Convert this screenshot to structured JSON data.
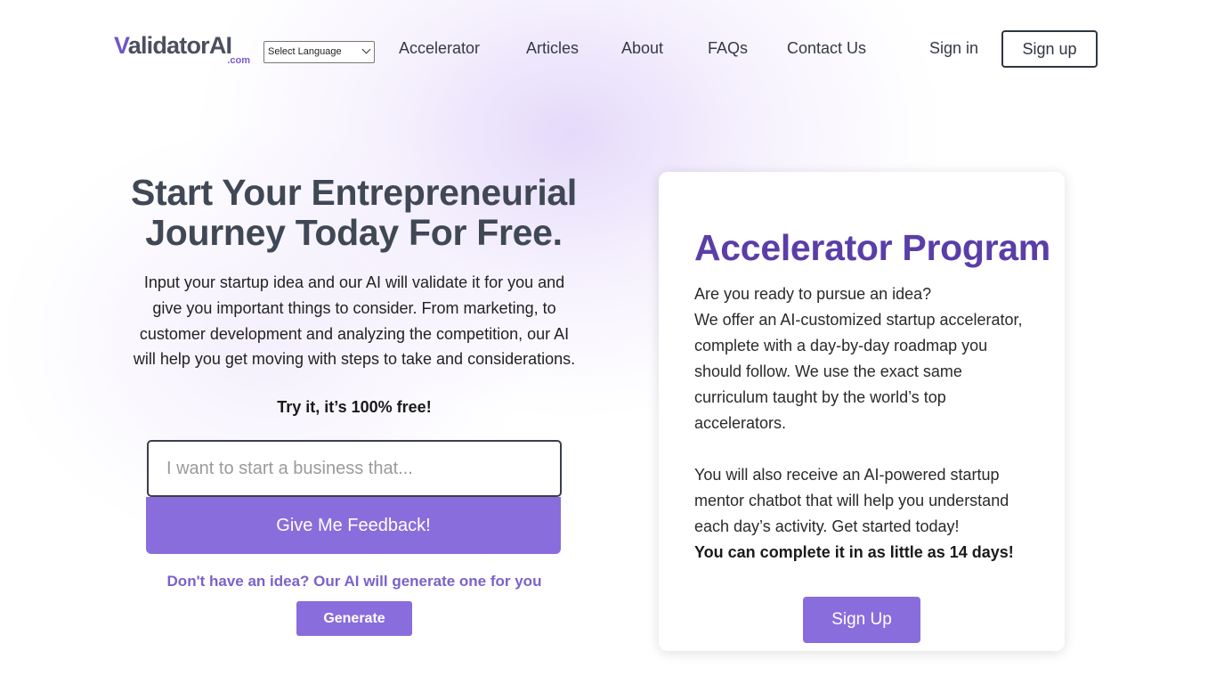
{
  "header": {
    "logo_text_v": "V",
    "logo_text_rest": "alidatorAI",
    "logo_domain": ".com",
    "language_select_value": "Select Language",
    "nav": [
      "Accelerator",
      "Articles",
      "About",
      "FAQs",
      "Contact Us"
    ],
    "sign_in": "Sign in",
    "sign_up": "Sign up"
  },
  "hero": {
    "title": "Start Your Entrepreneurial Journey Today For Free.",
    "description": "Input your startup idea and our AI will validate it for you and give you important things to consider. From marketing, to customer development and analyzing the competition, our AI will help you get moving with steps to take and considerations.",
    "free_line": "Try it, it’s 100% free!",
    "input_placeholder": "I want to start a business that...",
    "feedback_button": "Give Me Feedback!",
    "no_idea_text": "Don't have an idea? Our AI will generate one for you",
    "generate_button": "Generate"
  },
  "accelerator_card": {
    "title": "Accelerator Program",
    "question": "Are you ready to pursue an idea?",
    "paragraph1": "We offer an AI-customized startup accelerator, complete with a day-by-day roadmap you should follow. We use the exact same curriculum taught by the world’s top accelerators.",
    "paragraph2": "You will also receive an AI-powered startup mentor chatbot that will help you understand each day’s activity. Get started today!",
    "highlight": "You can complete it in as little as 14 days!",
    "button": "Sign Up"
  },
  "colors": {
    "brand_purple": "#8a6ddc",
    "title_purple": "#5a3ea8",
    "heading_gray": "#404856"
  }
}
